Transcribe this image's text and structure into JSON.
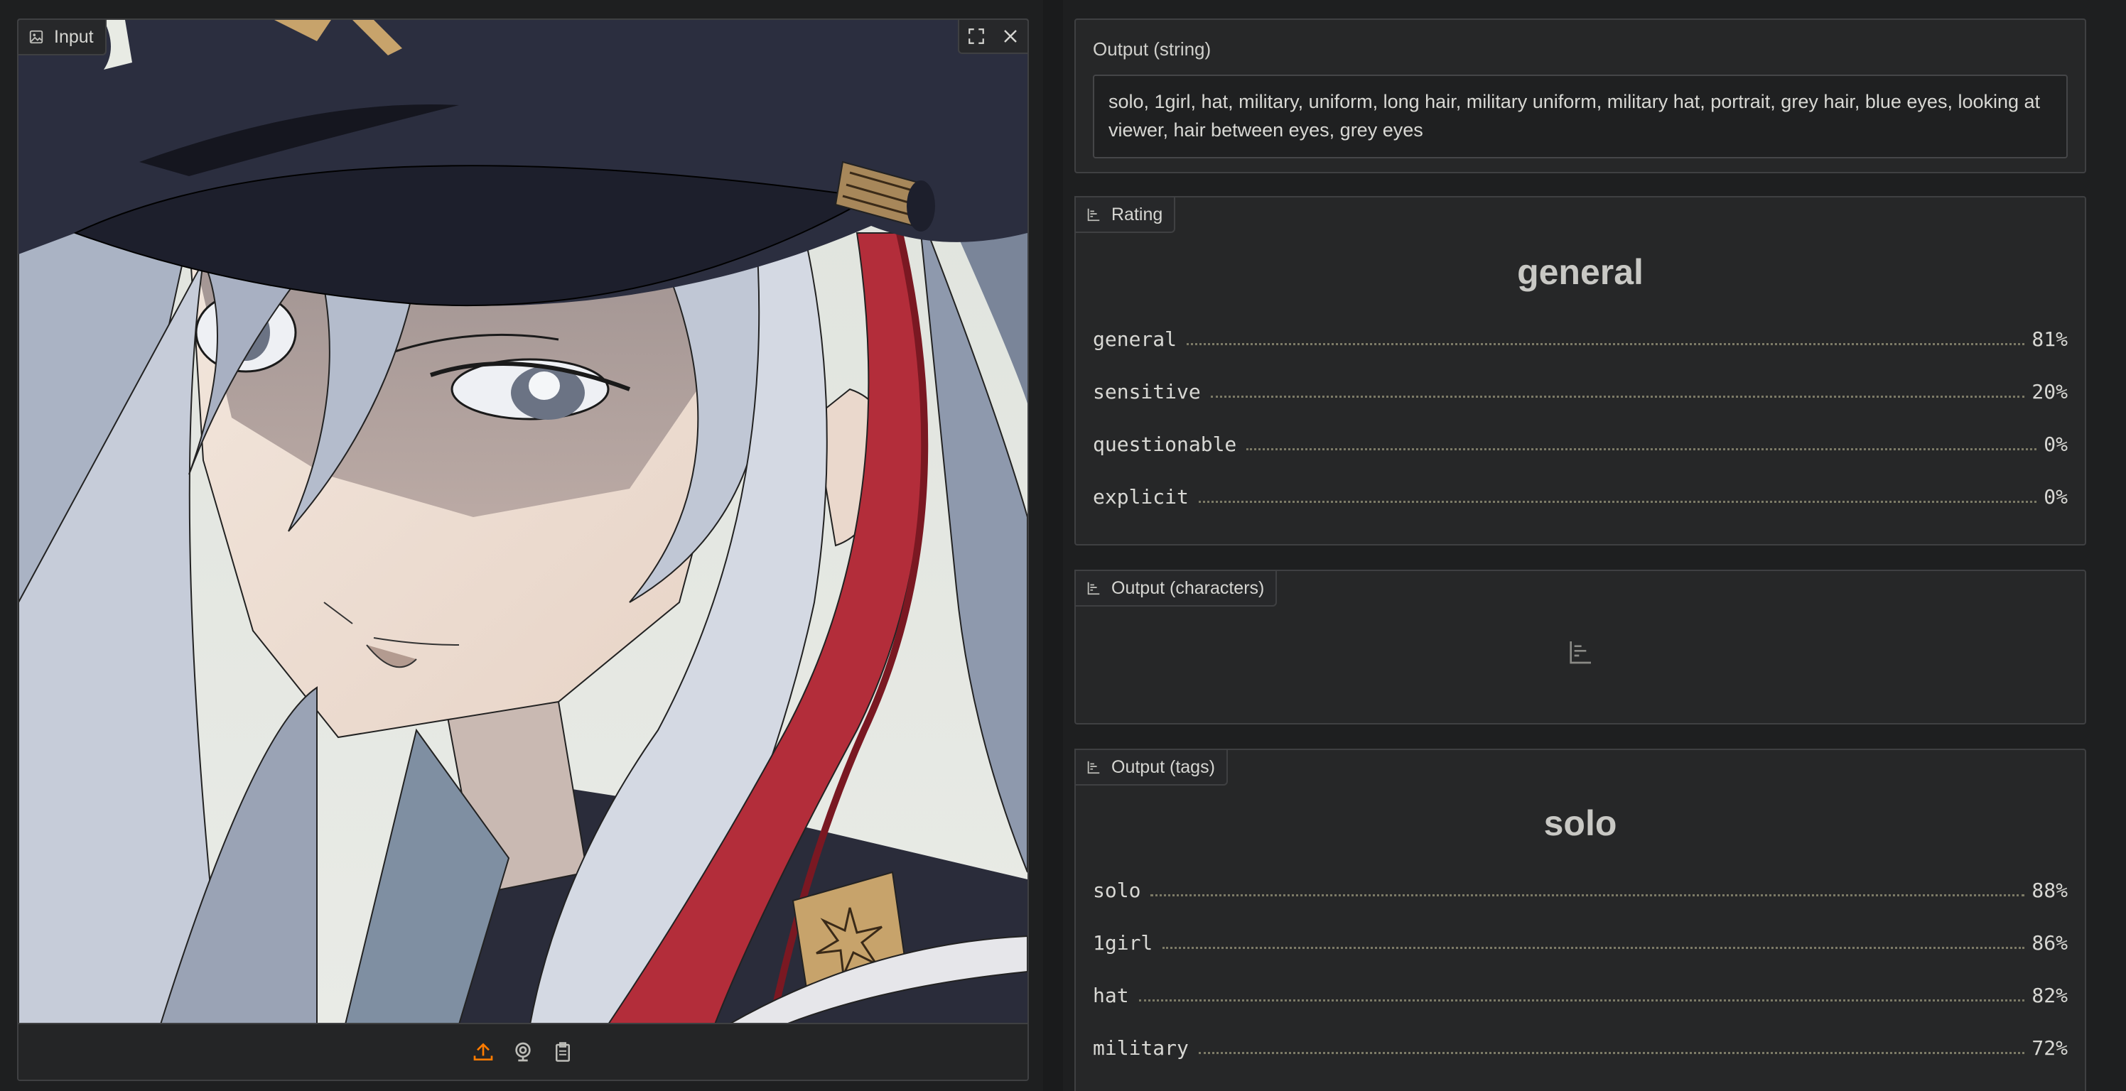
{
  "input": {
    "label": "Input",
    "icons": {
      "label": "image-icon",
      "fullscreen": "fullscreen-icon",
      "close": "close-icon",
      "upload": "upload-icon",
      "webcam": "webcam-icon",
      "clipboard": "clipboard-icon"
    }
  },
  "output_string": {
    "title": "Output (string)",
    "value": "solo, 1girl, hat, military, uniform, long hair, military uniform, military hat, portrait, grey hair, blue eyes, looking at viewer, hair between eyes, grey eyes"
  },
  "rating": {
    "label": "Rating",
    "top": "general",
    "rows": [
      {
        "name": "general",
        "pct": "81%"
      },
      {
        "name": "sensitive",
        "pct": "20%"
      },
      {
        "name": "questionable",
        "pct": "0%"
      },
      {
        "name": "explicit",
        "pct": "0%"
      }
    ]
  },
  "characters": {
    "label": "Output (characters)"
  },
  "tags": {
    "label": "Output (tags)",
    "top": "solo",
    "rows": [
      {
        "name": "solo",
        "pct": "88%"
      },
      {
        "name": "1girl",
        "pct": "86%"
      },
      {
        "name": "hat",
        "pct": "82%"
      },
      {
        "name": "military",
        "pct": "72%"
      }
    ]
  },
  "colors": {
    "background": "#1e1f20",
    "panel": "#262728",
    "border": "#3f4042",
    "accent": "#ff7c00"
  }
}
